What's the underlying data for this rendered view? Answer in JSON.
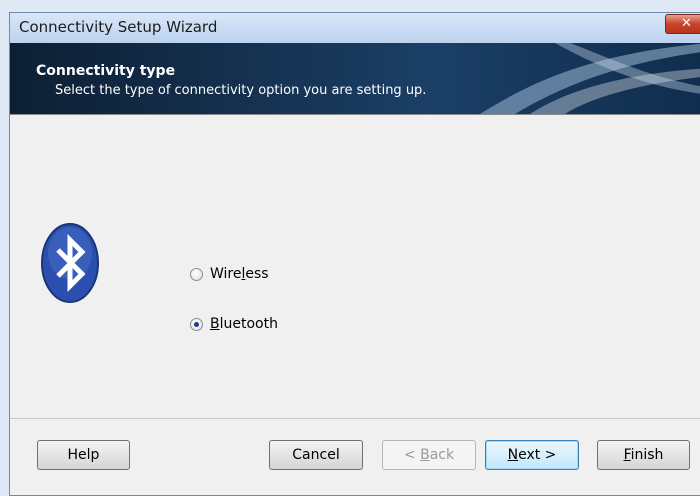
{
  "window": {
    "title": "Connectivity Setup Wizard",
    "close_glyph": "✕"
  },
  "header": {
    "title": "Connectivity type",
    "subtitle": "Select the type of connectivity option you are setting up."
  },
  "options": [
    {
      "label_pre": "Wire",
      "label_ul": "l",
      "label_post": "ess",
      "checked": false
    },
    {
      "label_pre": "",
      "label_ul": "B",
      "label_post": "luetooth",
      "checked": true
    }
  ],
  "buttons": {
    "help": "Help",
    "cancel": "Cancel",
    "back_pre": "< ",
    "back_ul": "B",
    "back_post": "ack",
    "next_ul": "N",
    "next_post": "ext >",
    "finish_ul": "F",
    "finish_post": "inish"
  },
  "icon": {
    "name": "bluetooth-icon",
    "color": "#2b4fae"
  }
}
